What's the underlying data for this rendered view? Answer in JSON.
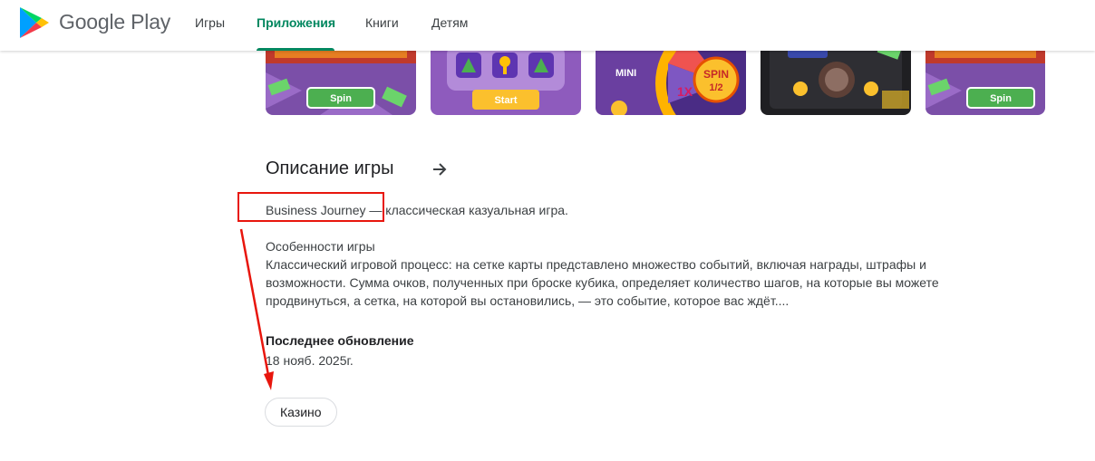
{
  "header": {
    "brand": "Google Play",
    "logo_icon": "google-play-logo-icon",
    "tabs": [
      {
        "label": "Игры",
        "active": false
      },
      {
        "label": "Приложения",
        "active": true
      },
      {
        "label": "Книги",
        "active": false
      },
      {
        "label": "Детям",
        "active": false
      }
    ],
    "accent_color": "#01875f"
  },
  "screenshots": [
    {
      "button_label": "Spin"
    },
    {
      "button_label": "Start"
    },
    {
      "wheel_labels": [
        "MINI",
        "1X",
        "SPIN",
        "1/2"
      ]
    },
    {
      "caption": ""
    },
    {
      "button_label": "Spin"
    }
  ],
  "description": {
    "title": "Описание игры",
    "arrow_icon": "arrow-right-icon",
    "intro": "Business Journey — классическая казуальная игра.",
    "features_heading": "Особенности игры",
    "features_text": "Классический игровой процесс: на сетке карты представлено множество событий, включая награды, штрафы и возможности. Сумма очков, полученных при броске кубика, определяет количество шагов, на которые вы можете продвинуться, а сетка, на которой вы остановились, — это событие, которое вас ждёт...."
  },
  "updated": {
    "label": "Последнее обновление",
    "value": "18 нояб. 2025г."
  },
  "category_chip": "Казино",
  "annotation_color": "#e8160d"
}
